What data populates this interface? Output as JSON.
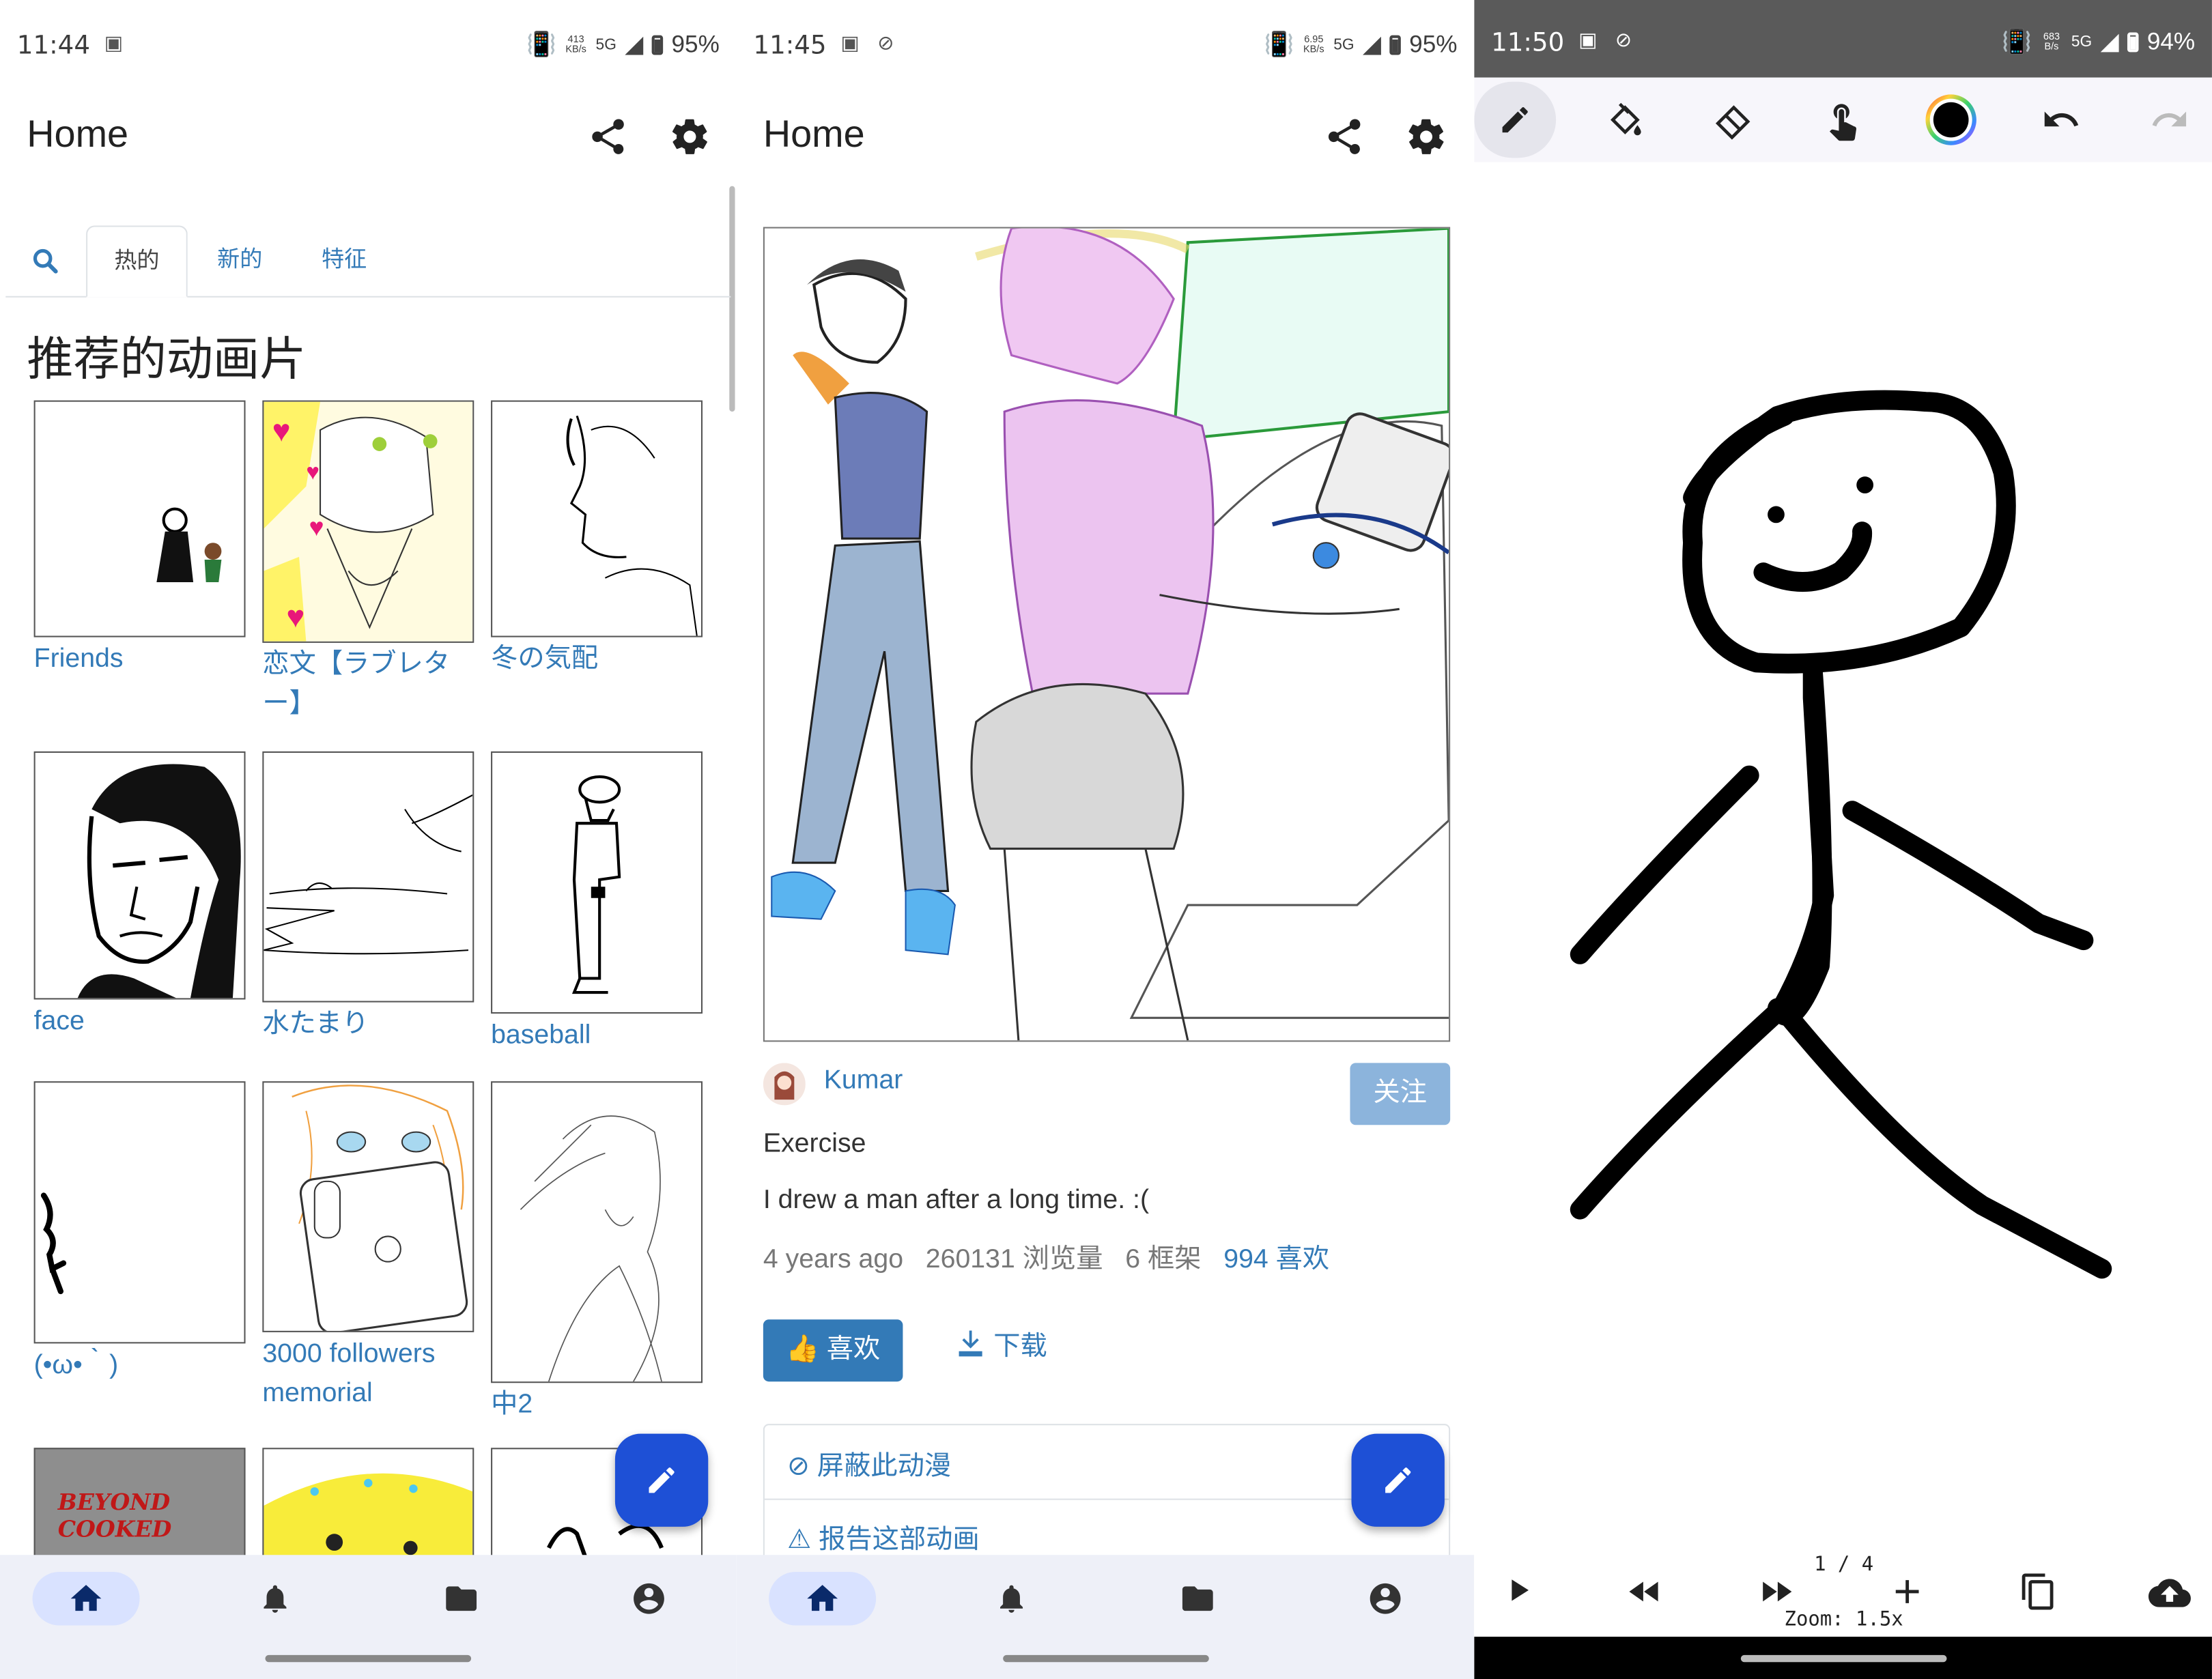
{
  "panel1": {
    "status": {
      "time": "11:44",
      "speed_top": "413",
      "speed_unit": "KB/s",
      "network": "5G",
      "battery": "95%"
    },
    "appbar": {
      "title": "Home"
    },
    "tabs": [
      "热的",
      "新的",
      "特征"
    ],
    "section_title": "推荐的动画片",
    "cards": [
      {
        "label": "Friends"
      },
      {
        "label": "恋文【ラブレター】"
      },
      {
        "label": "冬の気配"
      },
      {
        "label": "face"
      },
      {
        "label": "水たまり"
      },
      {
        "label": "baseball"
      },
      {
        "label": "(•ω•｀)"
      },
      {
        "label": "3000 followers memorial"
      },
      {
        "label": "中2"
      },
      {
        "thumb_text": "BEYOND COOKED"
      }
    ]
  },
  "panel2": {
    "status": {
      "time": "11:45",
      "speed_top": "6.95",
      "speed_unit": "KB/s",
      "network": "5G",
      "battery": "95%"
    },
    "appbar": {
      "title": "Home"
    },
    "author": "Kumar",
    "follow_label": "关注",
    "title": "Exercise",
    "description": "I drew a man after a long time. :(",
    "stats": {
      "age": "4 years ago",
      "views": "260131 浏览量",
      "frames": "6 框架",
      "likes": "994 喜欢"
    },
    "like_label": "喜欢",
    "download_label": "下载",
    "block_label": "屏蔽此动漫",
    "report_label": "报告这部动画"
  },
  "panel3": {
    "status": {
      "time": "11:50",
      "speed_top": "683",
      "speed_unit": "B/s",
      "network": "5G",
      "battery": "94%"
    },
    "frame_counter": "1 / 4",
    "zoom": "Zoom: 1.5x",
    "colors": {
      "stroke": "#000000",
      "accent": "#1e50d6"
    }
  }
}
